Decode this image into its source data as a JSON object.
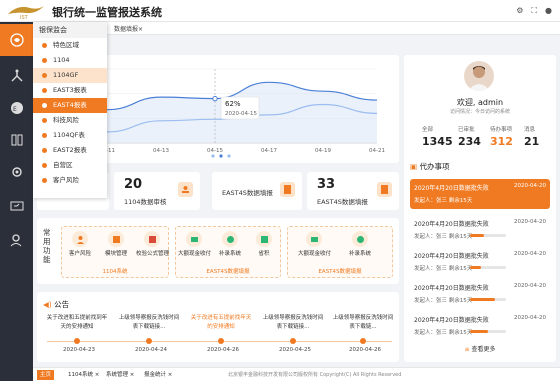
{
  "header": {
    "app_title": "银行统一监管报送系统"
  },
  "tabs": {
    "tab1": "数据填报",
    "close": "×"
  },
  "submenu": {
    "title": "银保监会",
    "items": [
      {
        "label": "特色区域"
      },
      {
        "label": "1104"
      },
      {
        "label": "1104GF"
      },
      {
        "label": "EAST3报表"
      },
      {
        "label": "EAST4报表"
      },
      {
        "label": "科技风险"
      },
      {
        "label": "1104QF表"
      },
      {
        "label": "EAST2报表"
      },
      {
        "label": "自营区"
      },
      {
        "label": "客户风险"
      }
    ]
  },
  "chart_data": {
    "type": "line",
    "x": [
      "04-11",
      "04-13",
      "04-15",
      "04-17",
      "04-19",
      "04-21"
    ],
    "series": [
      {
        "values": [
          45,
          62,
          60,
          82,
          70,
          58
        ]
      },
      {
        "values": [
          15,
          30,
          32,
          38,
          52,
          40
        ]
      }
    ],
    "tooltip": {
      "value": "62%",
      "date": "2020-04-15"
    },
    "ylim": [
      0,
      100
    ],
    "legend": "none",
    "colors": [
      "#4a7fd6",
      "#9bbdf0"
    ]
  },
  "cards": [
    {
      "num": "",
      "label": ""
    },
    {
      "num": "20",
      "label": "1104数据审核"
    },
    {
      "num": "",
      "label": "EAST4S数据填报"
    },
    {
      "num": "33",
      "label": "EAST4S数据填报"
    }
  ],
  "common": {
    "label": "常用功能",
    "groups": [
      {
        "caption": "1104系统",
        "items": [
          "客户风险",
          "模块管理",
          "校验公式管理"
        ]
      },
      {
        "caption": "EAST4S数据填报",
        "items": [
          "大额现金收付",
          "补录系统",
          "省积"
        ]
      },
      {
        "caption": "EAST4S数据填报",
        "items": [
          "大额现金收付",
          "补录系统"
        ]
      }
    ]
  },
  "notice": {
    "title": "公告",
    "items": [
      {
        "text": "关于改进和五提前找到年天的安排通知",
        "date": "2020-04-23"
      },
      {
        "text": "上级领导察报反洗钱时间表下载链接...",
        "date": "2020-04-24"
      },
      {
        "text": "关于改进有五提前找年天的安排通知",
        "date": "2020-04-26"
      },
      {
        "text": "上级领导察报反洗钱时间表下载链接...",
        "date": "2020-04-25"
      },
      {
        "text": "上级领导察报反洗钱时间表下载链...",
        "date": "2020-04-26"
      }
    ]
  },
  "profile": {
    "welcome": "欢迎, admin",
    "last_login": "访问情况：今日访问的系统",
    "stats": [
      {
        "label": "全部",
        "value": "1345"
      },
      {
        "label": "已审批",
        "value": "234"
      },
      {
        "label": "待办事项",
        "value": "312"
      },
      {
        "label": "消息",
        "value": "21"
      }
    ]
  },
  "todo": {
    "title": "代办事项",
    "items": [
      {
        "title": "2020年4月20日数据批失败",
        "date": "2020-04-20",
        "meta": "发起人：张三  剩余15天",
        "progress": 0.6
      },
      {
        "title": "2020年4月20日数据批失败",
        "date": "2020-04-20",
        "meta": "发起人：张三  剩余15天",
        "progress": 0.4
      },
      {
        "title": "2020年4月20日数据批失败",
        "date": "2020-04-20",
        "meta": "发起人：张三  剩余15天",
        "progress": 0.3
      },
      {
        "title": "2020年4月20日数据批失败",
        "date": "2020-04-20",
        "meta": "发起人：张三  剩余15天",
        "progress": 0.7
      },
      {
        "title": "2020年4月20日数据批失败",
        "date": "2020-04-20",
        "meta": "发起人：张三  剩余15天",
        "progress": 0.5
      }
    ],
    "more": "查看更多"
  },
  "footer": {
    "tabs": [
      "主页",
      "1104系统 ×",
      "系统管理 ×",
      "报金统计 ×"
    ],
    "copyright": "北京银丰金融科技开发有限公司版权所有 Copyright(C)   All Rights Reserved"
  }
}
